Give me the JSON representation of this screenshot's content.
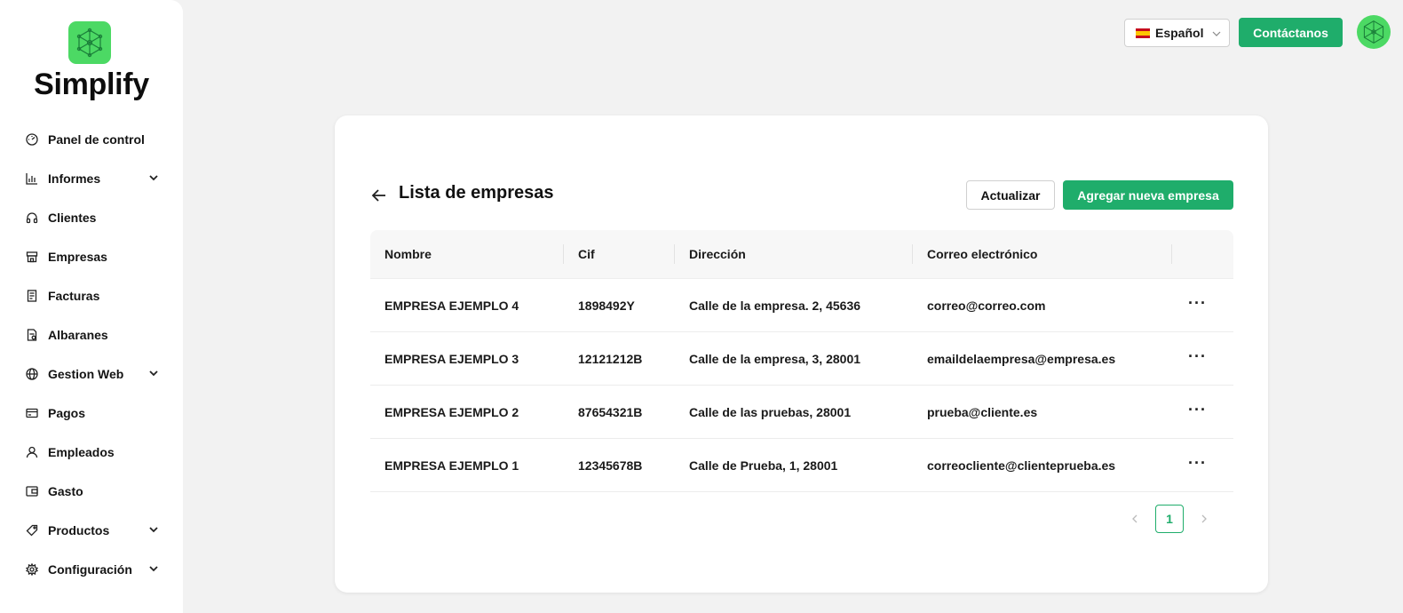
{
  "brand": {
    "name": "Simplify"
  },
  "sidebar": {
    "items": [
      {
        "label": "Panel de control",
        "icon": "dashboard-icon",
        "expandable": false
      },
      {
        "label": "Informes",
        "icon": "chart-icon",
        "expandable": true
      },
      {
        "label": "Clientes",
        "icon": "headphones-icon",
        "expandable": false
      },
      {
        "label": "Empresas",
        "icon": "store-icon",
        "expandable": false
      },
      {
        "label": "Facturas",
        "icon": "invoice-icon",
        "expandable": false
      },
      {
        "label": "Albaranes",
        "icon": "delivery-note-icon",
        "expandable": false
      },
      {
        "label": "Gestion Web",
        "icon": "globe-icon",
        "expandable": true
      },
      {
        "label": "Pagos",
        "icon": "card-icon",
        "expandable": false
      },
      {
        "label": "Empleados",
        "icon": "user-icon",
        "expandable": false
      },
      {
        "label": "Gasto",
        "icon": "wallet-icon",
        "expandable": false
      },
      {
        "label": "Productos",
        "icon": "tag-icon",
        "expandable": true
      },
      {
        "label": "Configuración",
        "icon": "gear-icon",
        "expandable": true
      }
    ]
  },
  "header": {
    "language": "Español",
    "contact_label": "Contáctanos"
  },
  "main": {
    "title": "Lista de empresas",
    "update_label": "Actualizar",
    "add_label": "Agregar nueva empresa",
    "table": {
      "columns": [
        "Nombre",
        "Cif",
        "Dirección",
        "Correo electrónico"
      ],
      "rows": [
        {
          "nombre": "EMPRESA EJEMPLO 4",
          "cif": "1898492Y",
          "direccion": "Calle de la empresa. 2, 45636",
          "correo": "correo@correo.com"
        },
        {
          "nombre": "EMPRESA EJEMPLO 3",
          "cif": "12121212B",
          "direccion": "Calle de la empresa, 3, 28001",
          "correo": "emaildelaempresa@empresa.es"
        },
        {
          "nombre": "EMPRESA EJEMPLO 2",
          "cif": "87654321B",
          "direccion": "Calle de las pruebas, 28001",
          "correo": "prueba@cliente.es"
        },
        {
          "nombre": "EMPRESA EJEMPLO 1",
          "cif": "12345678B",
          "direccion": "Calle de Prueba, 1, 28001",
          "correo": "correocliente@clienteprueba.es"
        }
      ],
      "row_actions_label": "···"
    },
    "pagination": {
      "current_page": "1"
    }
  },
  "colors": {
    "accent": "#1fad6b",
    "logo": "#4cd964",
    "background": "#f2f2f2"
  }
}
